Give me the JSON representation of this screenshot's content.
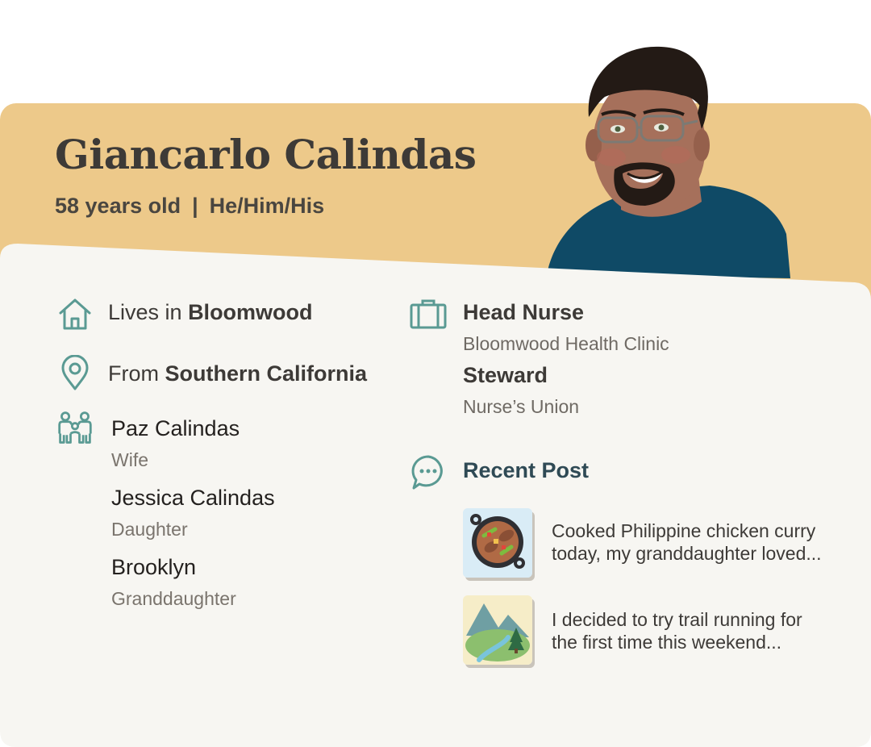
{
  "profile": {
    "name": "Giancarlo Calindas",
    "age": "58 years old",
    "separator": "|",
    "pronouns": "He/Him/His"
  },
  "details": {
    "lives_prefix": "Lives in ",
    "lives_place": "Bloomwood",
    "from_prefix": "From ",
    "from_place": "Southern California"
  },
  "family": [
    {
      "name": "Paz Calindas",
      "role": "Wife"
    },
    {
      "name": "Jessica Calindas",
      "role": "Daughter"
    },
    {
      "name": "Brooklyn",
      "role": "Granddaughter"
    }
  ],
  "work": [
    {
      "title": "Head Nurse",
      "org": "Bloomwood Health Clinic"
    },
    {
      "title": "Steward",
      "org": "Nurse’s Union"
    }
  ],
  "recent_post": {
    "title": "Recent Post",
    "posts": [
      {
        "line1": "Cooked Philippine chicken curry",
        "line2": "today, my granddaughter loved...",
        "icon": "curry-pan-icon"
      },
      {
        "line1": "I decided to try trail running for",
        "line2": "the first time this weekend...",
        "icon": "mountain-trail-icon"
      }
    ]
  },
  "colors": {
    "header": "#edc98a",
    "card": "#f7f6f2",
    "icon_teal": "#5a9a93",
    "shirt": "#0f4a66"
  }
}
